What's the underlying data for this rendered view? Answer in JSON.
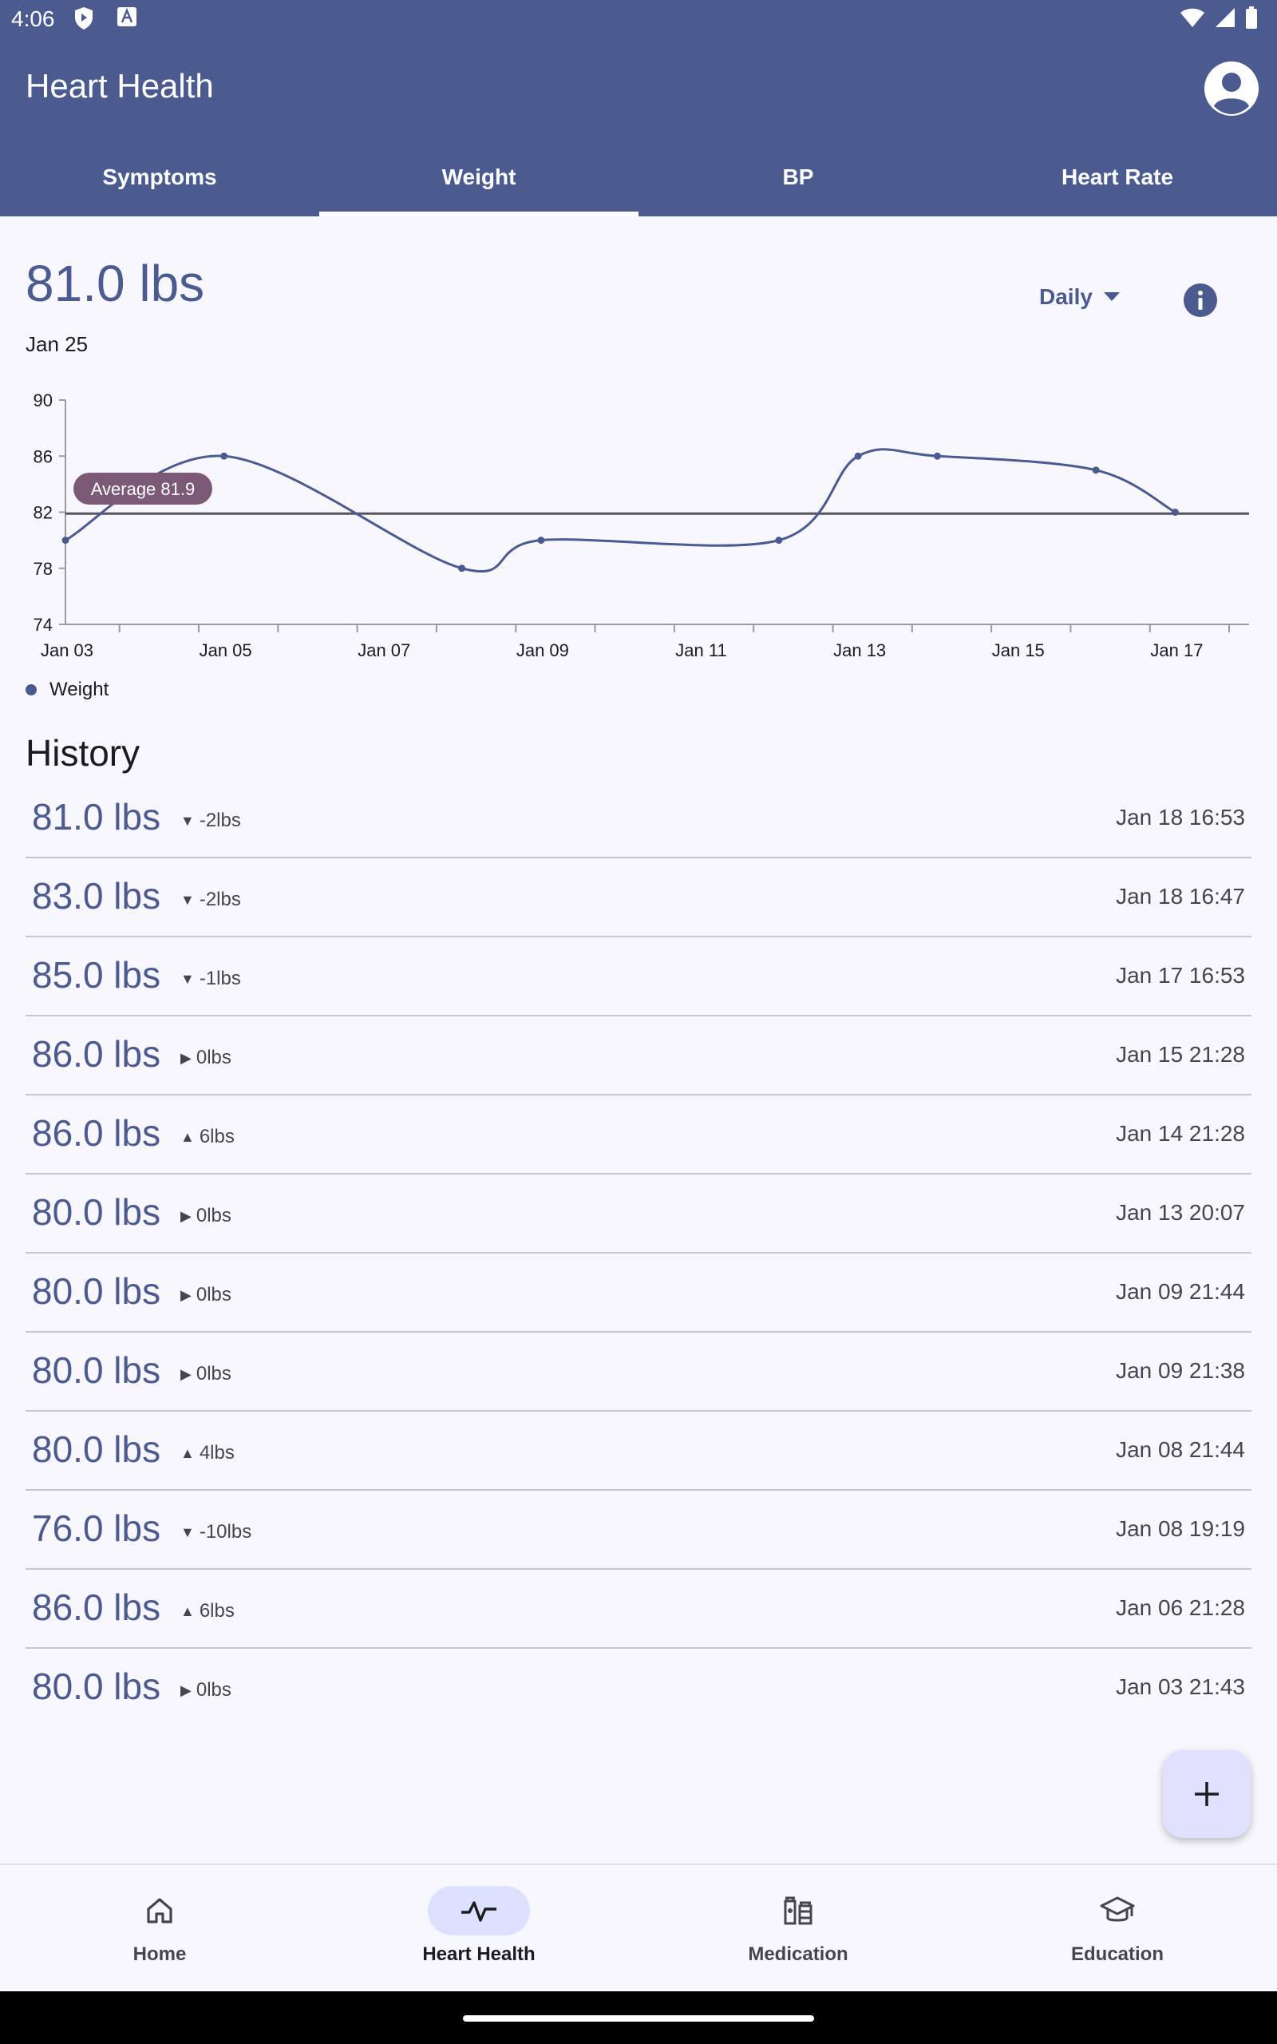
{
  "status_bar": {
    "time": "4:06"
  },
  "app": {
    "title": "Heart Health"
  },
  "tabs": [
    {
      "label": "Symptoms",
      "active": false
    },
    {
      "label": "Weight",
      "active": true
    },
    {
      "label": "BP",
      "active": false
    },
    {
      "label": "Heart Rate",
      "active": false
    }
  ],
  "summary": {
    "value": "81.0 lbs",
    "date": "Jan 25",
    "period": "Daily"
  },
  "chart_data": {
    "type": "line",
    "x": [
      "Jan 03",
      "Jan 05",
      "Jan 08",
      "Jan 09",
      "Jan 12",
      "Jan 13",
      "Jan 14",
      "Jan 16",
      "Jan 17"
    ],
    "series": [
      {
        "name": "Weight",
        "values": [
          80,
          86,
          78,
          80,
          80,
          86,
          86,
          85,
          82
        ]
      }
    ],
    "x_ticks": [
      "Jan 03",
      "Jan 05",
      "Jan 07",
      "Jan 09",
      "Jan 11",
      "Jan 13",
      "Jan 15",
      "Jan 17"
    ],
    "y_ticks": [
      90,
      86,
      82,
      78,
      74
    ],
    "ylim": [
      74,
      90
    ],
    "average": 81.9,
    "average_label": "Average 81.9",
    "legend": "Weight",
    "legend_position": "bottom-left",
    "color": "#4b5b8f"
  },
  "history": {
    "title": "History",
    "items": [
      {
        "value": "81.0 lbs",
        "dir": "down",
        "delta": "-2lbs",
        "time": "Jan 18 16:53"
      },
      {
        "value": "83.0 lbs",
        "dir": "down",
        "delta": "-2lbs",
        "time": "Jan 18 16:47"
      },
      {
        "value": "85.0 lbs",
        "dir": "down",
        "delta": "-1lbs",
        "time": "Jan 17 16:53"
      },
      {
        "value": "86.0 lbs",
        "dir": "flat",
        "delta": "0lbs",
        "time": "Jan 15 21:28"
      },
      {
        "value": "86.0 lbs",
        "dir": "up",
        "delta": "6lbs",
        "time": "Jan 14 21:28"
      },
      {
        "value": "80.0 lbs",
        "dir": "flat",
        "delta": "0lbs",
        "time": "Jan 13 20:07"
      },
      {
        "value": "80.0 lbs",
        "dir": "flat",
        "delta": "0lbs",
        "time": "Jan 09 21:44"
      },
      {
        "value": "80.0 lbs",
        "dir": "flat",
        "delta": "0lbs",
        "time": "Jan 09 21:38"
      },
      {
        "value": "80.0 lbs",
        "dir": "up",
        "delta": "4lbs",
        "time": "Jan 08 21:44"
      },
      {
        "value": "76.0 lbs",
        "dir": "down",
        "delta": "-10lbs",
        "time": "Jan 08 19:19"
      },
      {
        "value": "86.0 lbs",
        "dir": "up",
        "delta": "6lbs",
        "time": "Jan 06 21:28"
      },
      {
        "value": "80.0 lbs",
        "dir": "flat",
        "delta": "0lbs",
        "time": "Jan 03 21:43"
      }
    ]
  },
  "fab": {
    "icon": "plus-icon",
    "label": "+"
  },
  "bottom_nav": [
    {
      "label": "Home",
      "icon": "home-icon",
      "active": false
    },
    {
      "label": "Heart Health",
      "icon": "heart-pulse-icon",
      "active": true
    },
    {
      "label": "Medication",
      "icon": "medication-icon",
      "active": false
    },
    {
      "label": "Education",
      "icon": "graduation-cap-icon",
      "active": false
    }
  ],
  "colors": {
    "primary": "#4b5b8f",
    "background": "#f8f7fd",
    "average_badge": "#7b5a78",
    "nav_active": "#dce1ff",
    "fab": "#dfe1ff"
  }
}
